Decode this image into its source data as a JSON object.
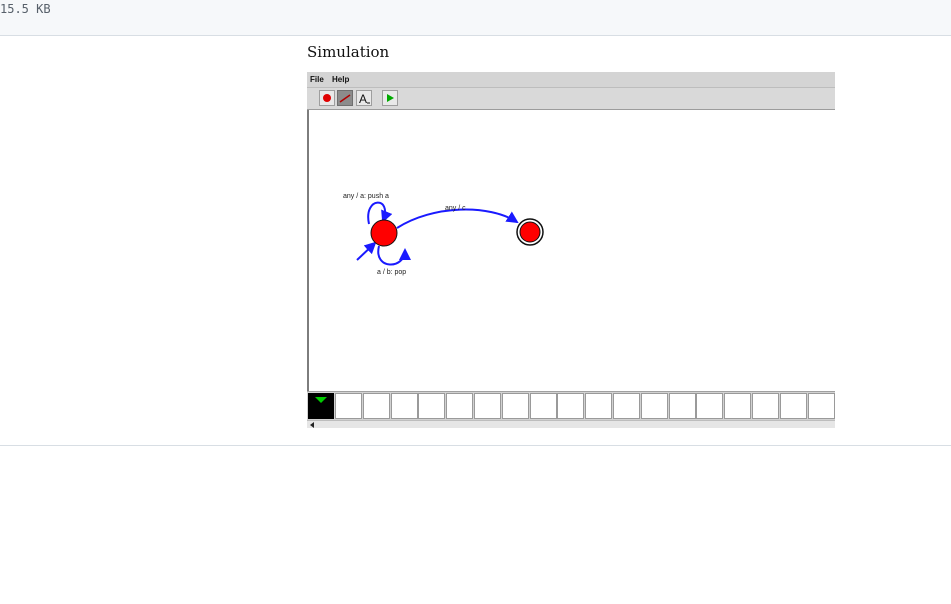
{
  "file_info": {
    "size": "15.5 KB"
  },
  "caption": "Simulation",
  "app": {
    "menu": [
      "File",
      "Help"
    ],
    "toolbar": {
      "tools": [
        {
          "icon": "state-tool-icon",
          "selected": false
        },
        {
          "icon": "transition-tool-icon",
          "selected": true
        },
        {
          "icon": "text-tool-icon",
          "selected": false
        },
        {
          "icon": "run-icon",
          "selected": false
        }
      ]
    },
    "diagram": {
      "states": [
        {
          "id": "q0",
          "initial": true,
          "final": false,
          "color": "#ff0000"
        },
        {
          "id": "q1",
          "initial": false,
          "final": true,
          "color": "#ff0000"
        }
      ],
      "transitions": [
        {
          "from": "q0",
          "to": "q0",
          "label": "any / a: push a"
        },
        {
          "from": "q0",
          "to": "q0",
          "label": "a / b: pop"
        },
        {
          "from": "q0",
          "to": "q1",
          "label": "any / c"
        }
      ],
      "edge_color": "#1a1aff"
    },
    "tape": {
      "head_position": 0,
      "visible_cells": 18,
      "head_marker_color": "#00cc00"
    }
  }
}
